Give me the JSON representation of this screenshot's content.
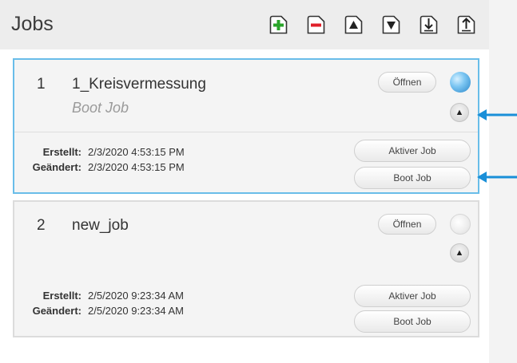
{
  "panel": {
    "title": "Jobs",
    "toolbar": [
      {
        "name": "add-job-button",
        "icon": "plus-icon"
      },
      {
        "name": "remove-job-button",
        "icon": "minus-icon"
      },
      {
        "name": "move-up-button",
        "icon": "triangle-up-icon"
      },
      {
        "name": "move-down-button",
        "icon": "triangle-down-icon"
      },
      {
        "name": "import-button",
        "icon": "download-icon"
      },
      {
        "name": "export-button",
        "icon": "upload-icon"
      }
    ]
  },
  "jobs": [
    {
      "number": "1",
      "name": "1_Kreisvermessung",
      "subtitle": "Boot Job",
      "open_label": "Öffnen",
      "status": "active",
      "created_label": "Erstellt:",
      "created": "2/3/2020 4:53:15 PM",
      "modified_label": "Geändert:",
      "modified": "2/3/2020 4:53:15 PM",
      "active_label": "Aktiver Job",
      "boot_label": "Boot Job"
    },
    {
      "number": "2",
      "name": "new_job",
      "subtitle": "",
      "open_label": "Öffnen",
      "status": "inactive",
      "created_label": "Erstellt:",
      "created": "2/5/2020 9:23:34 AM",
      "modified_label": "Geändert:",
      "modified": "2/5/2020 9:23:34 AM",
      "active_label": "Aktiver Job",
      "boot_label": "Boot Job"
    }
  ],
  "colors": {
    "accent": "#69bde9",
    "annotation_arrow": "#1a8fd8",
    "add_icon": "#2aa52a",
    "remove_icon": "#e0202a"
  }
}
